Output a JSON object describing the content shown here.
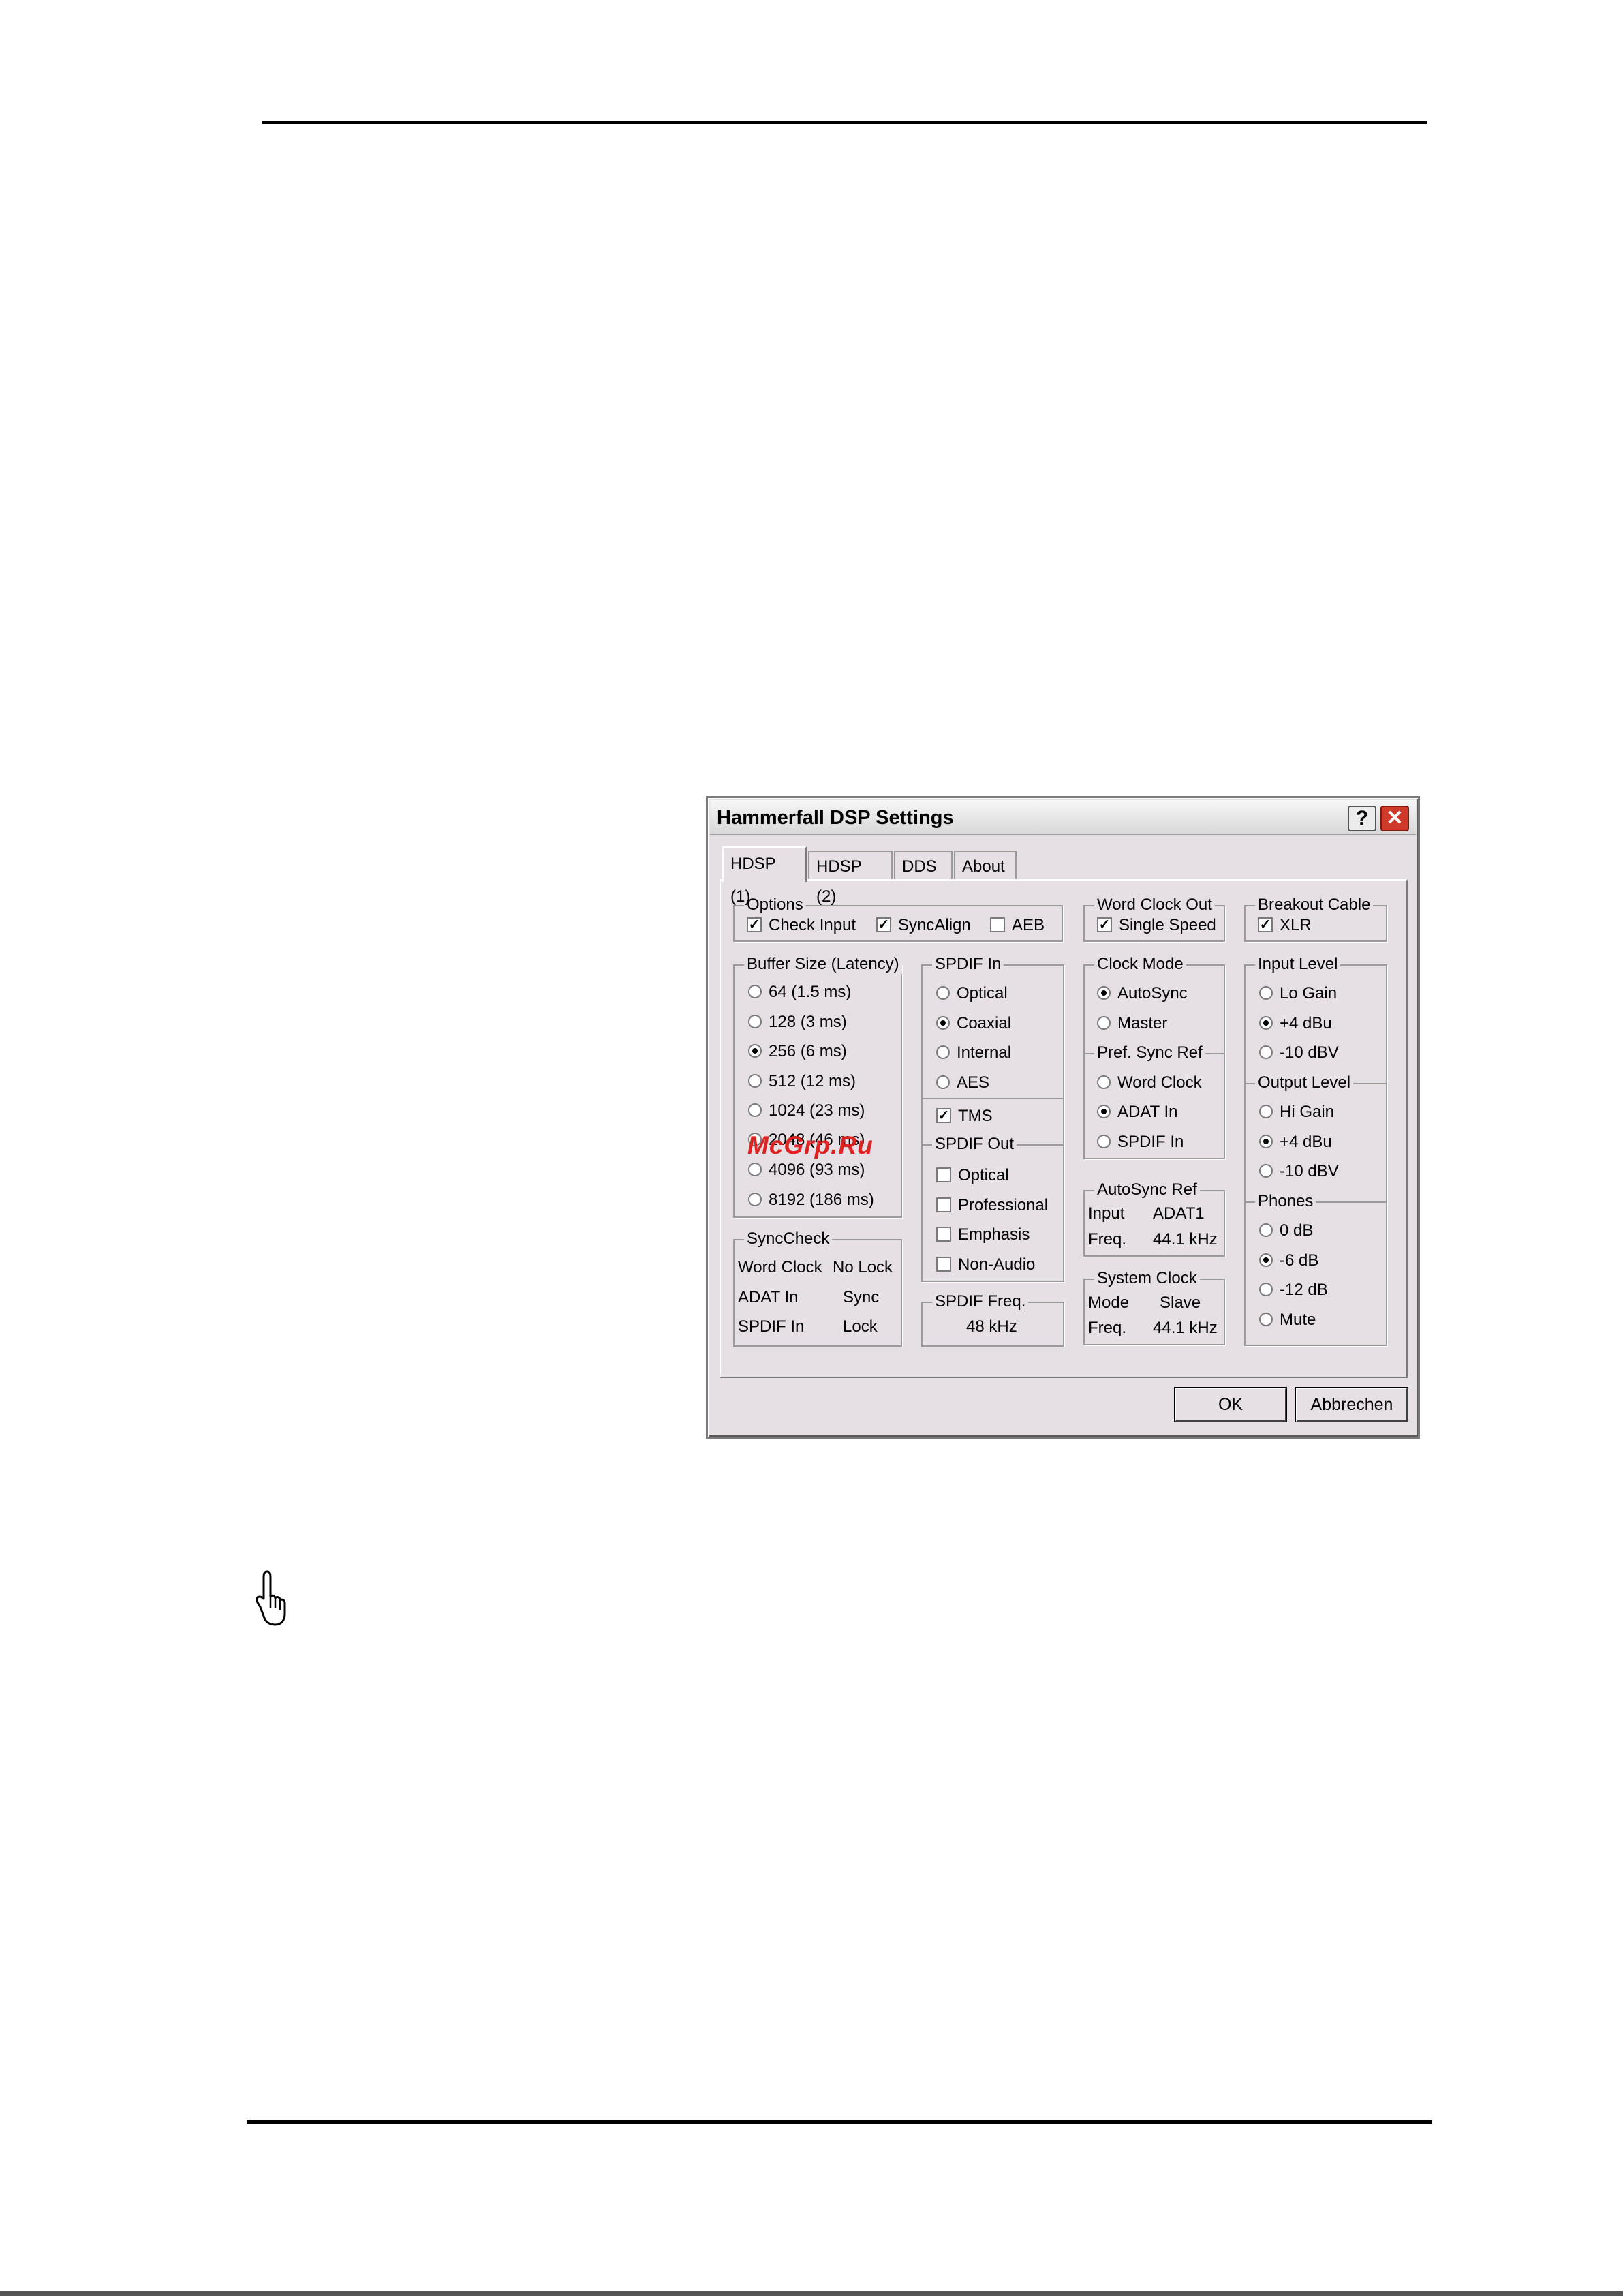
{
  "dialog": {
    "title": "Hammerfall DSP Settings",
    "help_symbol": "?",
    "close_symbol": "✕"
  },
  "tabs": [
    "HDSP (1)",
    "HDSP (2)",
    "DDS",
    "About"
  ],
  "options": {
    "label": "Options",
    "check_input": "Check Input",
    "sync_align": "SyncAlign",
    "aeb": "AEB"
  },
  "word_clock_out": {
    "label": "Word Clock Out",
    "single_speed": "Single Speed"
  },
  "breakout_cable": {
    "label": "Breakout Cable",
    "xlr": "XLR"
  },
  "buffer_size": {
    "label": "Buffer Size (Latency)",
    "options": [
      "64 (1.5 ms)",
      "128 (3 ms)",
      "256 (6 ms)",
      "512 (12 ms)",
      "1024 (23 ms)",
      "2048 (46 ms)",
      "4096 (93 ms)",
      "8192 (186 ms)"
    ],
    "selected": 2
  },
  "spdif_in": {
    "label": "SPDIF In",
    "options": [
      "Optical",
      "Coaxial",
      "Internal",
      "AES"
    ],
    "selected": 1,
    "tms": "TMS"
  },
  "spdif_out": {
    "label": "SPDIF Out",
    "options": [
      "Optical",
      "Professional",
      "Emphasis",
      "Non-Audio"
    ]
  },
  "spdif_freq": {
    "label": "SPDIF Freq.",
    "value": "48 kHz"
  },
  "clock_mode": {
    "label": "Clock Mode",
    "options": [
      "AutoSync",
      "Master"
    ],
    "selected": 0
  },
  "pref_sync_ref": {
    "label": "Pref. Sync Ref",
    "options": [
      "Word Clock",
      "ADAT In",
      "SPDIF In"
    ],
    "selected": 1
  },
  "autosync_ref": {
    "label": "AutoSync Ref",
    "input_label": "Input",
    "input_value": "ADAT1",
    "freq_label": "Freq.",
    "freq_value": "44.1 kHz"
  },
  "system_clock": {
    "label": "System Clock",
    "mode_label": "Mode",
    "mode_value": "Slave",
    "freq_label": "Freq.",
    "freq_value": "44.1 kHz"
  },
  "input_level": {
    "label": "Input Level",
    "options": [
      "Lo Gain",
      "+4 dBu",
      "-10 dBV"
    ],
    "selected": 1
  },
  "output_level": {
    "label": "Output Level",
    "options": [
      "Hi Gain",
      "+4 dBu",
      "-10 dBV"
    ],
    "selected": 1
  },
  "phones": {
    "label": "Phones",
    "options": [
      "0 dB",
      "-6 dB",
      "-12 dB",
      "Mute"
    ],
    "selected": 1
  },
  "synccheck": {
    "label": "SyncCheck",
    "rows": [
      {
        "name": "Word Clock",
        "status": "No Lock"
      },
      {
        "name": "ADAT In",
        "status": "Sync"
      },
      {
        "name": "SPDIF In",
        "status": "Lock"
      }
    ]
  },
  "buttons": {
    "ok": "OK",
    "cancel": "Abbrechen"
  },
  "watermark": "McGrp.Ru"
}
